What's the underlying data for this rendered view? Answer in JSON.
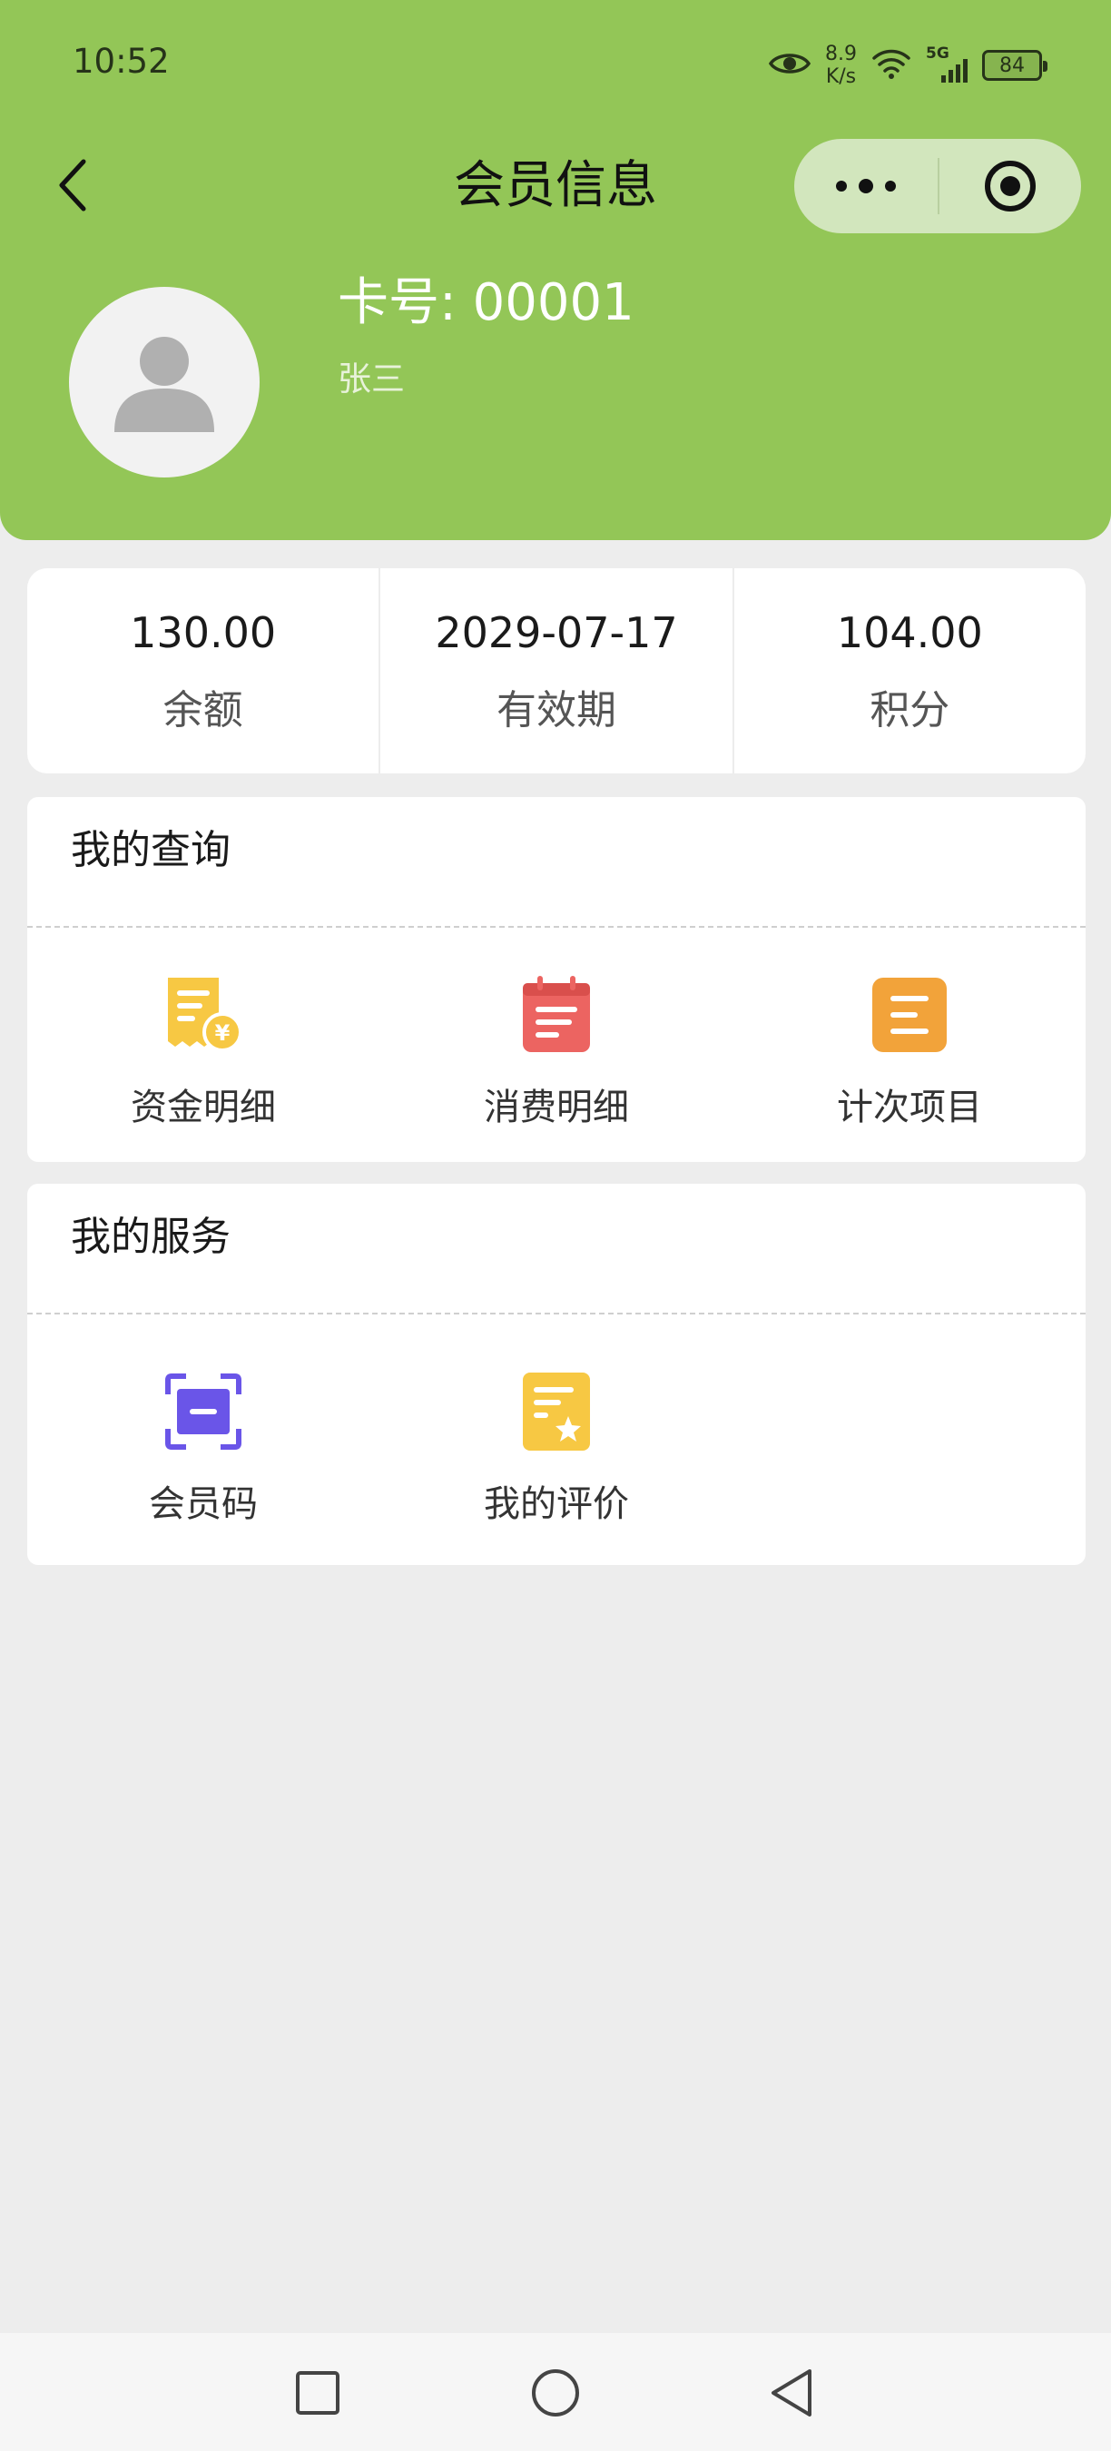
{
  "status_bar": {
    "time": "10:52",
    "speed_value": "8.9",
    "speed_unit": "K/s",
    "network": "5G",
    "battery": "84"
  },
  "nav": {
    "title": "会员信息"
  },
  "profile": {
    "card_number": "卡号: 00001",
    "name": "张三"
  },
  "stats": [
    {
      "value": "130.00",
      "label": "余额"
    },
    {
      "value": "2029-07-17",
      "label": "有效期"
    },
    {
      "value": "104.00",
      "label": "积分"
    }
  ],
  "query_section": {
    "title": "我的查询",
    "items": [
      {
        "label": "资金明细",
        "icon": "fund-detail-icon",
        "color": "#f7c843"
      },
      {
        "label": "消费明细",
        "icon": "consume-calendar-icon",
        "color": "#ec6461"
      },
      {
        "label": "计次项目",
        "icon": "count-list-icon",
        "color": "#f2a33a"
      }
    ]
  },
  "service_section": {
    "title": "我的服务",
    "items": [
      {
        "label": "会员码",
        "icon": "member-code-scan-icon",
        "color": "#6a55e8"
      },
      {
        "label": "我的评价",
        "icon": "review-star-icon",
        "color": "#f7c843"
      }
    ]
  },
  "colors": {
    "header_bg": "#93c657",
    "capsule_bg": "#d2e6bd",
    "page_bg": "#ededed"
  }
}
